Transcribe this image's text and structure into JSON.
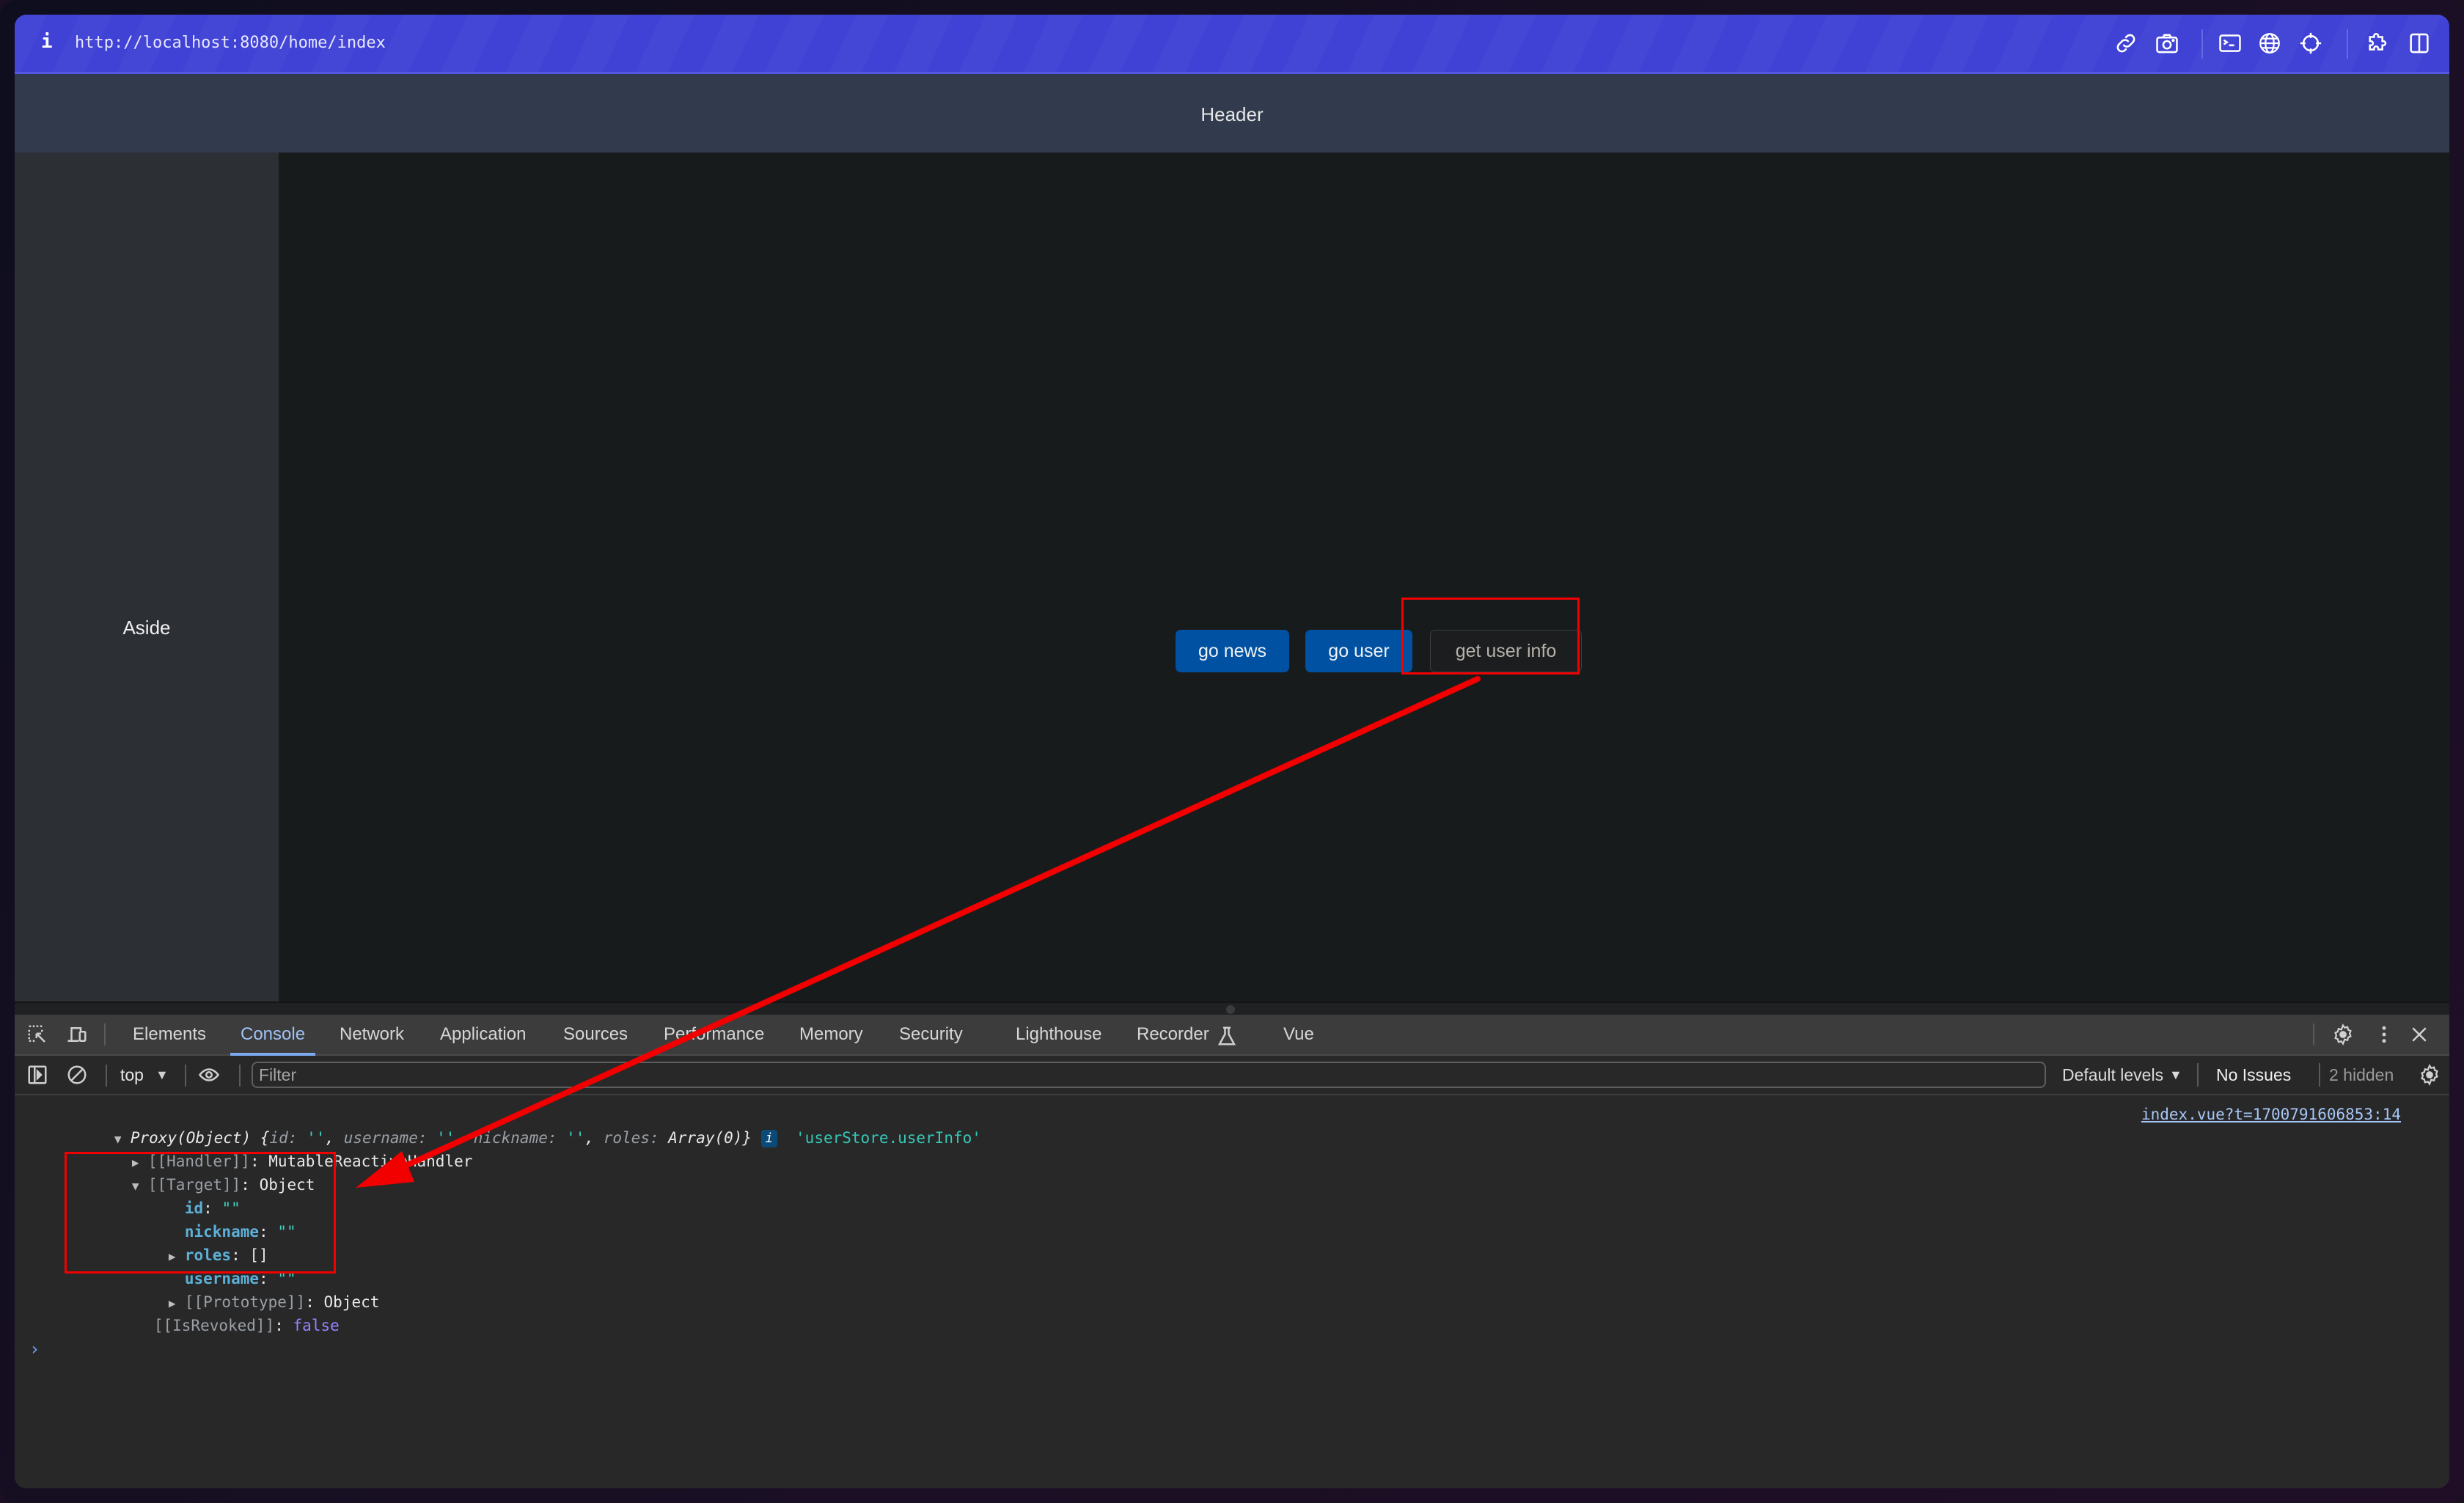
{
  "browser": {
    "info_icon_label": "i",
    "url": "http://localhost:8080/home/index",
    "toolbar_icons": [
      "link-icon",
      "camera-icon",
      "terminal-icon",
      "globe-icon",
      "crosshair-icon",
      "puzzle-icon",
      "split-panel-icon"
    ]
  },
  "page": {
    "header": "Header",
    "aside": "Aside",
    "buttons": {
      "go_news": "go news",
      "go_user": "go user",
      "get_user_info": "get user info"
    }
  },
  "devtools": {
    "tabs": [
      "Elements",
      "Console",
      "Network",
      "Application",
      "Sources",
      "Performance",
      "Memory",
      "Security",
      "Lighthouse",
      "Recorder",
      "Vue"
    ],
    "active_tab": "Console",
    "console_toolbar": {
      "context": "top",
      "filter_placeholder": "Filter",
      "levels": "Default levels",
      "issues": "No Issues",
      "hidden": "2 hidden"
    },
    "console": {
      "source_link": "index.vue?t=1700791606853:14",
      "summary": {
        "prefix": "Proxy(Object) {",
        "id_key": "id: ",
        "id_val": "''",
        "username_key": "username: ",
        "username_val": "''",
        "nickname_key": "nickname: ",
        "nickname_val": "''",
        "roles_key": "roles: ",
        "roles_val": "Array(0)",
        "suffix": "}",
        "comma": ", ",
        "label": "'userStore.userInfo'",
        "info_badge": "i"
      },
      "handler": {
        "key": "[[Handler]]",
        "value": "MutableReactiveHandler"
      },
      "target": {
        "key": "[[Target]]",
        "value": "Object"
      },
      "fields": [
        {
          "key": "id",
          "value": "\"\""
        },
        {
          "key": "nickname",
          "value": "\"\""
        },
        {
          "key": "roles",
          "value": "[]"
        },
        {
          "key": "username",
          "value": "\"\""
        }
      ],
      "prototype": {
        "key": "[[Prototype]]",
        "value": "Object"
      },
      "revoked": {
        "key": "[[IsRevoked]]",
        "value": "false"
      },
      "colon": ": ",
      "prompt": "›"
    }
  },
  "annotation": {
    "color": "#f20000"
  }
}
